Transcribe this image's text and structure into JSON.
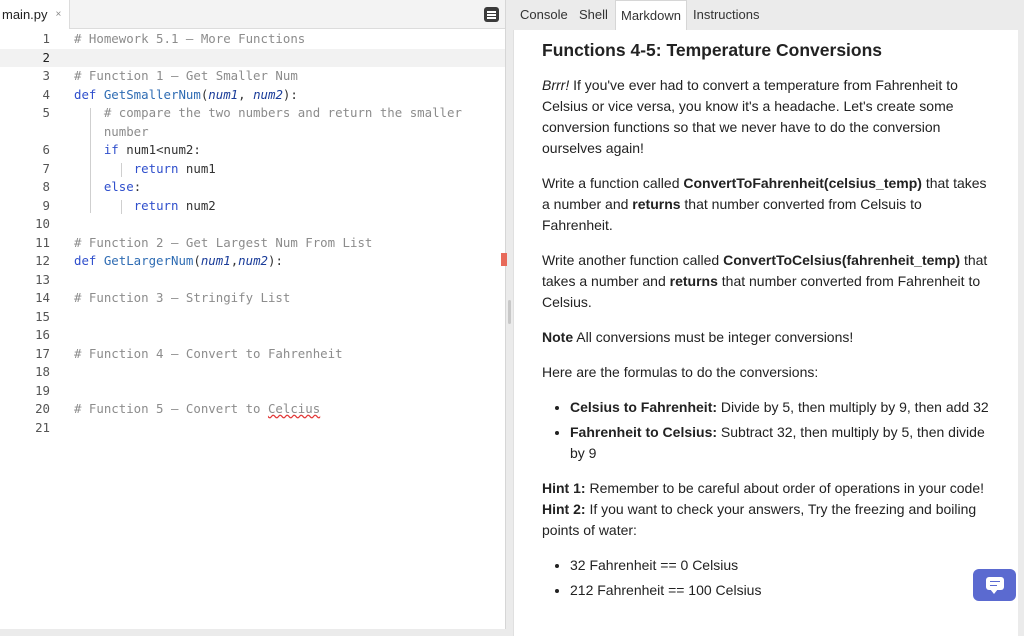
{
  "editor": {
    "file_tab": "main.py",
    "close_glyph": "×",
    "lines": [
      {
        "n": "1",
        "parts": [
          {
            "c": "cm",
            "t": "# Homework 5.1 – More Functions"
          }
        ]
      },
      {
        "n": "2",
        "parts": []
      },
      {
        "n": "3",
        "parts": [
          {
            "c": "cm",
            "t": "# Function 1 – Get Smaller Num"
          }
        ]
      },
      {
        "n": "4",
        "parts": [
          {
            "c": "kw",
            "t": "def "
          },
          {
            "c": "fn",
            "t": "GetSmallerNum"
          },
          {
            "c": "",
            "t": "("
          },
          {
            "c": "prm",
            "t": "num1"
          },
          {
            "c": "",
            "t": ", "
          },
          {
            "c": "prm",
            "t": "num2"
          },
          {
            "c": "",
            "t": "):"
          }
        ]
      },
      {
        "n": "5",
        "parts": [
          {
            "c": "cm",
            "t": "    # compare the two numbers and return the smaller"
          }
        ]
      },
      {
        "n": "",
        "parts": [
          {
            "c": "cm",
            "t": "    number"
          }
        ]
      },
      {
        "n": "6",
        "parts": [
          {
            "c": "",
            "t": "    "
          },
          {
            "c": "kw",
            "t": "if "
          },
          {
            "c": "",
            "t": "num1<num2:"
          }
        ]
      },
      {
        "n": "7",
        "parts": [
          {
            "c": "",
            "t": "        "
          },
          {
            "c": "kw",
            "t": "return "
          },
          {
            "c": "",
            "t": "num1"
          }
        ]
      },
      {
        "n": "8",
        "parts": [
          {
            "c": "",
            "t": "    "
          },
          {
            "c": "kw",
            "t": "else"
          },
          {
            "c": "",
            "t": ":"
          }
        ]
      },
      {
        "n": "9",
        "parts": [
          {
            "c": "",
            "t": "        "
          },
          {
            "c": "kw",
            "t": "return "
          },
          {
            "c": "",
            "t": "num2"
          }
        ]
      },
      {
        "n": "10",
        "parts": []
      },
      {
        "n": "11",
        "parts": [
          {
            "c": "cm",
            "t": "# Function 2 – Get Largest Num From List"
          }
        ]
      },
      {
        "n": "12",
        "parts": [
          {
            "c": "kw",
            "t": "def "
          },
          {
            "c": "fn",
            "t": "GetLargerNum"
          },
          {
            "c": "",
            "t": "("
          },
          {
            "c": "prm",
            "t": "num1"
          },
          {
            "c": "",
            "t": ","
          },
          {
            "c": "prm",
            "t": "num2"
          },
          {
            "c": "",
            "t": "):"
          }
        ]
      },
      {
        "n": "13",
        "parts": []
      },
      {
        "n": "14",
        "parts": [
          {
            "c": "cm",
            "t": "# Function 3 – Stringify List"
          }
        ]
      },
      {
        "n": "15",
        "parts": []
      },
      {
        "n": "16",
        "parts": []
      },
      {
        "n": "17",
        "parts": [
          {
            "c": "cm",
            "t": "# Function 4 – Convert to Fahrenheit"
          }
        ]
      },
      {
        "n": "18",
        "parts": []
      },
      {
        "n": "19",
        "parts": []
      },
      {
        "n": "20",
        "parts": [
          {
            "c": "cm",
            "t": "# Function 5 – Convert to "
          },
          {
            "c": "cm squig",
            "t": "Celcius"
          }
        ]
      },
      {
        "n": "21",
        "parts": []
      }
    ]
  },
  "panel_tabs": [
    {
      "label": "Console",
      "active": false
    },
    {
      "label": "Shell",
      "active": false
    },
    {
      "label": "Markdown",
      "active": true
    },
    {
      "label": "Instructions",
      "active": false
    }
  ],
  "doc": {
    "title": "Functions 4-5: Temperature Conversions",
    "intro_em": "Brrr!",
    "intro": " If you've ever had to convert a temperature from Fahrenheit to Celsius or vice versa, you know it's a headache. Let's create some conversion functions so that we never have to do the conversion ourselves again!",
    "p2_a": "Write a function called ",
    "p2_b": "ConvertToFahrenheit(celsius_temp)",
    "p2_c": " that takes a number and ",
    "p2_d": "returns",
    "p2_e": " that number converted from Celsuis to Fahrenheit.",
    "p3_a": "Write another function called ",
    "p3_b": "ConvertToCelsius(fahrenheit_temp)",
    "p3_c": " that takes a number and ",
    "p3_d": "returns",
    "p3_e": " that number converted from Fahrenheit to Celsius.",
    "note_b": "Note",
    "note": " All conversions must be integer conversions!",
    "formulas_intro": "Here are the formulas to do the conversions:",
    "f1_b": "Celsius to Fahrenheit:",
    "f1": " Divide by 5, then multiply by 9, then add 32",
    "f2_b": "Fahrenheit to Celsius:",
    "f2": " Subtract 32, then multiply by 5, then divide by 9",
    "hint1_b": "Hint 1:",
    "hint1": " Remember to be careful about order of operations in your code! ",
    "hint2_b": "Hint 2:",
    "hint2": " If you want to check your answers, Try the freezing and boiling points of water:",
    "check1": "32 Fahrenheit == 0 Celsius",
    "check2": "212 Fahrenheit == 100 Celsius"
  },
  "icons": {
    "menu": "document-menu-icon",
    "chat": "chat-bubble-icon"
  },
  "colors": {
    "accent": "#5b6ad0",
    "keyword": "#2f4fcc",
    "comment": "#8c8c8c",
    "error": "#e86a5a"
  }
}
